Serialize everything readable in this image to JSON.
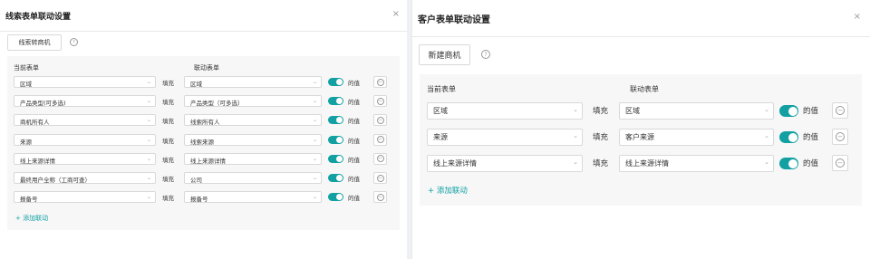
{
  "left": {
    "title": "线索表单联动设置",
    "close": "×",
    "button": "线索转商机",
    "help": "?",
    "col_current": "当前表单",
    "col_linked": "联动表单",
    "fill_label": "填充",
    "value_label": "的值",
    "add_link": "+ 添加联动",
    "rows": [
      {
        "current": "区域",
        "linked": "区域"
      },
      {
        "current": "产品类型(可多选)",
        "linked": "产品类型（可多选）"
      },
      {
        "current": "商机所有人",
        "linked": "线索所有人"
      },
      {
        "current": "来源",
        "linked": "线索来源"
      },
      {
        "current": "线上来源详情",
        "linked": "线上来源详情"
      },
      {
        "current": "最终用户全称（工商可查）",
        "linked": "公司"
      },
      {
        "current": "报备号",
        "linked": "报备号"
      }
    ]
  },
  "right": {
    "title": "客户表单联动设置",
    "close": "×",
    "button": "新建商机",
    "help": "?",
    "col_current": "当前表单",
    "col_linked": "联动表单",
    "fill_label": "填充",
    "value_label": "的值",
    "add_link": "+ 添加联动",
    "rows": [
      {
        "current": "区域",
        "linked": "区域"
      },
      {
        "current": "来源",
        "linked": "客户来源"
      },
      {
        "current": "线上来源详情",
        "linked": "线上来源详情"
      }
    ]
  },
  "icons": {
    "chevron": "chevron-down-icon",
    "toggle": "toggle-on",
    "remove": "minus-circle-icon"
  },
  "colors": {
    "accent": "#12a0a3"
  }
}
